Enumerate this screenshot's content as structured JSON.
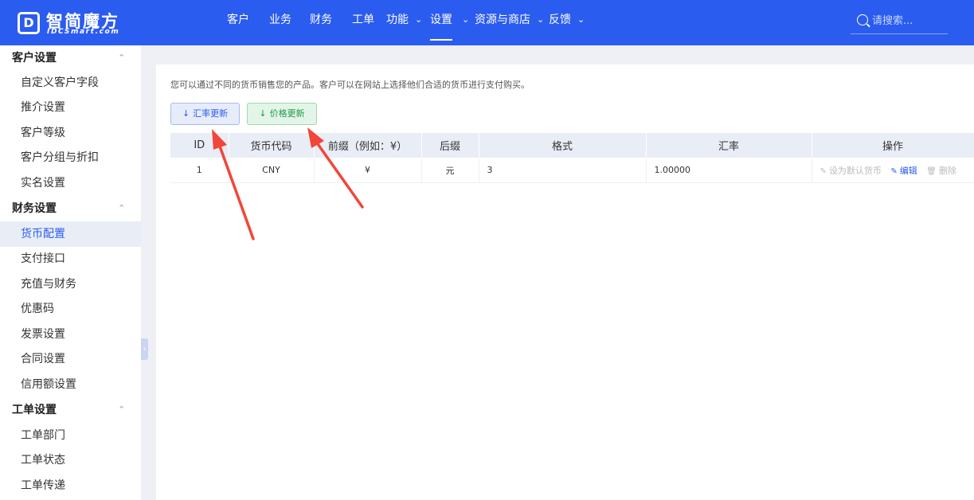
{
  "brand": {
    "mark": "D",
    "title": "智简魔方",
    "subtitle": "IDCSmart.com"
  },
  "nav": {
    "items": [
      {
        "label": "客户"
      },
      {
        "label": "业务"
      },
      {
        "label": "财务"
      },
      {
        "label": "工单"
      },
      {
        "label": "功能"
      },
      {
        "label": "设置"
      },
      {
        "label": "资源与商店"
      },
      {
        "label": "反馈"
      }
    ],
    "active": "设置",
    "search_placeholder": "请搜索..."
  },
  "sidebar": {
    "groups": [
      {
        "label": "客户设置",
        "items": [
          "自定义客户字段",
          "推介设置",
          "客户等级",
          "客户分组与折扣",
          "实名设置"
        ]
      },
      {
        "label": "财务设置",
        "items": [
          "货币配置",
          "支付接口",
          "充值与财务",
          "优惠码",
          "发票设置",
          "合同设置",
          "信用额设置"
        ]
      },
      {
        "label": "工单设置",
        "items": [
          "工单部门",
          "工单状态",
          "工单传递"
        ]
      }
    ],
    "active_item": "货币配置"
  },
  "main": {
    "description": "您可以通过不同的货币销售您的产品。客户可以在网站上选择他们合适的货币进行支付购买。",
    "buttons": {
      "rate_update": "汇率更新",
      "price_update": "价格更新"
    },
    "table": {
      "headers": [
        "ID",
        "货币代码",
        "前缀（例如：¥）",
        "后缀",
        "格式",
        "汇率",
        "操作"
      ],
      "rows": [
        {
          "id": "1",
          "code": "CNY",
          "prefix": "¥",
          "suffix": "元",
          "format": "3",
          "rate": "1.00000",
          "actions": {
            "set_default": "设为默认货币",
            "edit": "编辑",
            "delete": "删除"
          }
        }
      ]
    }
  },
  "colors": {
    "primary": "#2b5cf0",
    "annotation": "#f2463a"
  }
}
